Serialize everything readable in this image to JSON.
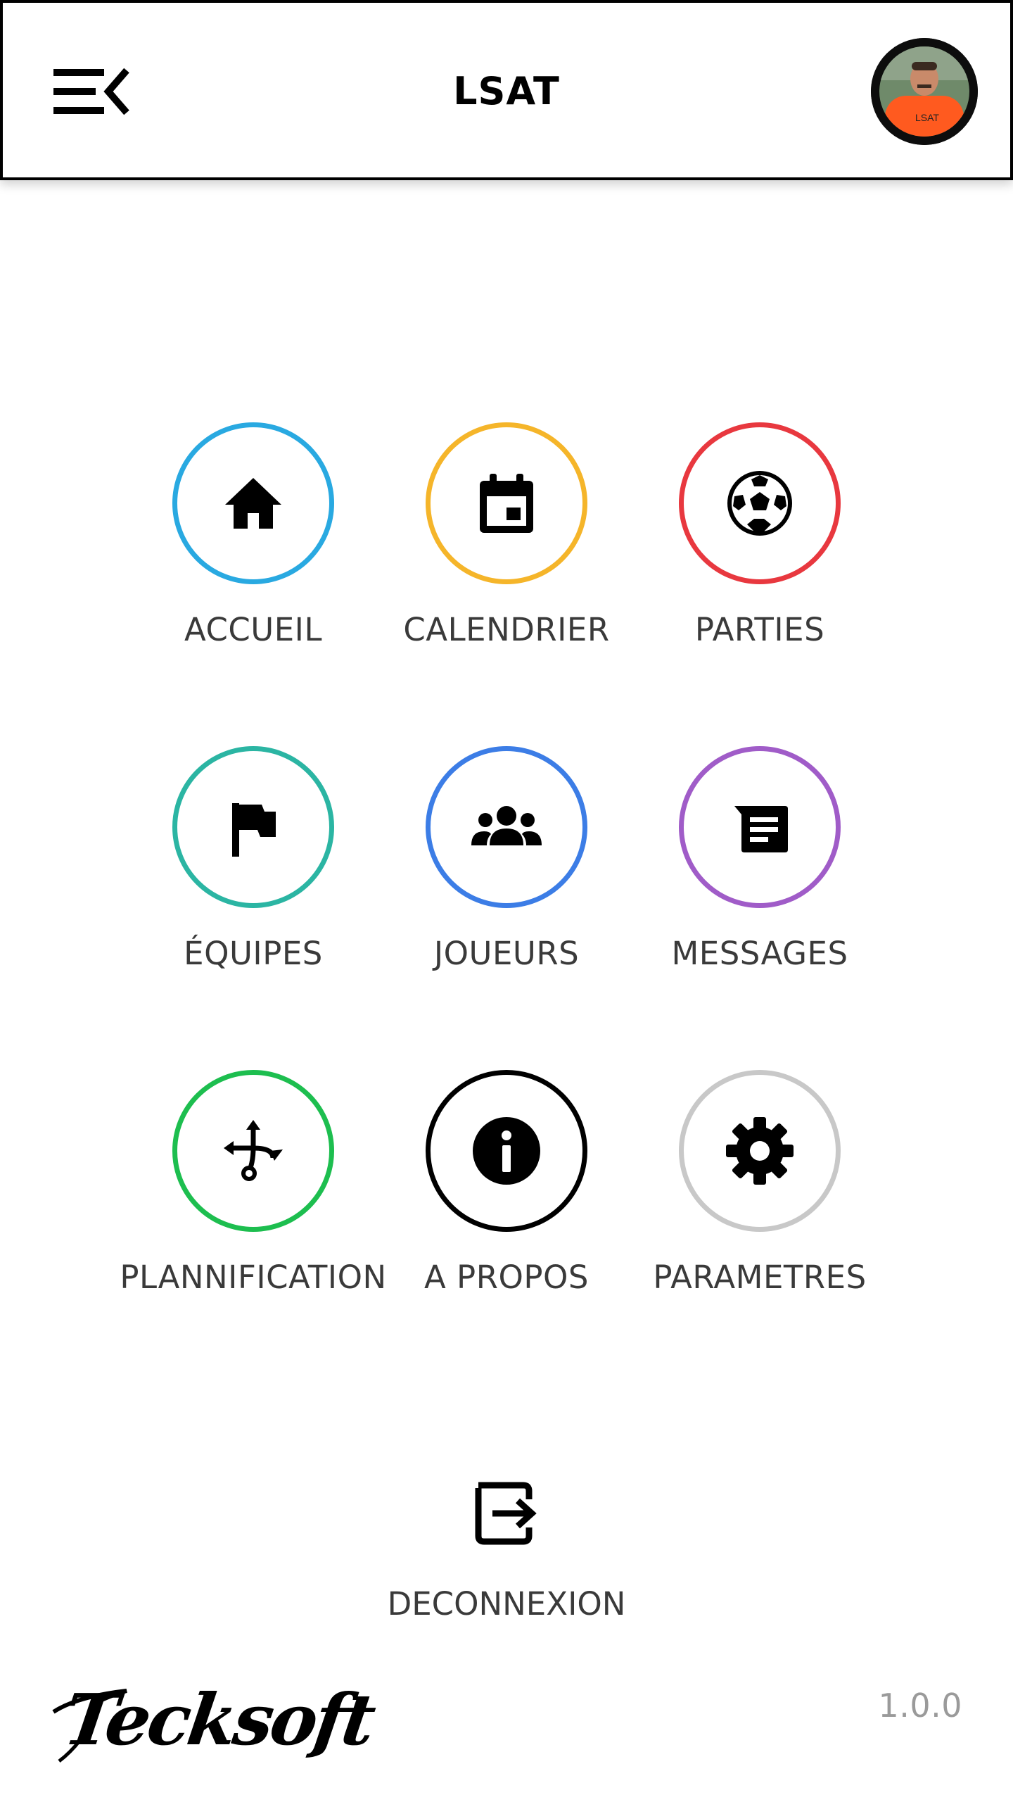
{
  "header": {
    "title": "LSAT",
    "menu_icon": "menu-collapse-icon",
    "avatar_jersey_text": "LSAT"
  },
  "menu": {
    "items": [
      {
        "label": "ACCUEIL",
        "icon": "home-icon",
        "color": "#29A9E1"
      },
      {
        "label": "CALENDRIER",
        "icon": "calendar-icon",
        "color": "#F5B52A"
      },
      {
        "label": "PARTIES",
        "icon": "soccer-ball-icon",
        "color": "#E8383F"
      },
      {
        "label": "ÉQUIPES",
        "icon": "flag-icon",
        "color": "#2BB5A3"
      },
      {
        "label": "JOUEURS",
        "icon": "group-icon",
        "color": "#3C7DE6"
      },
      {
        "label": "MESSAGES",
        "icon": "message-icon",
        "color": "#A05CC8"
      },
      {
        "label": "PLANNIFICATION",
        "icon": "fork-arrows-icon",
        "color": "#1DBE4F"
      },
      {
        "label": "A PROPOS",
        "icon": "info-icon",
        "color": "#000000"
      },
      {
        "label": "PARAMETRES",
        "icon": "gear-icon",
        "color": "#C8C8C8"
      }
    ]
  },
  "logout": {
    "label": "DECONNEXION",
    "icon": "logout-icon"
  },
  "footer": {
    "logo_text": "Tecksoft",
    "version": "1.0.0"
  }
}
